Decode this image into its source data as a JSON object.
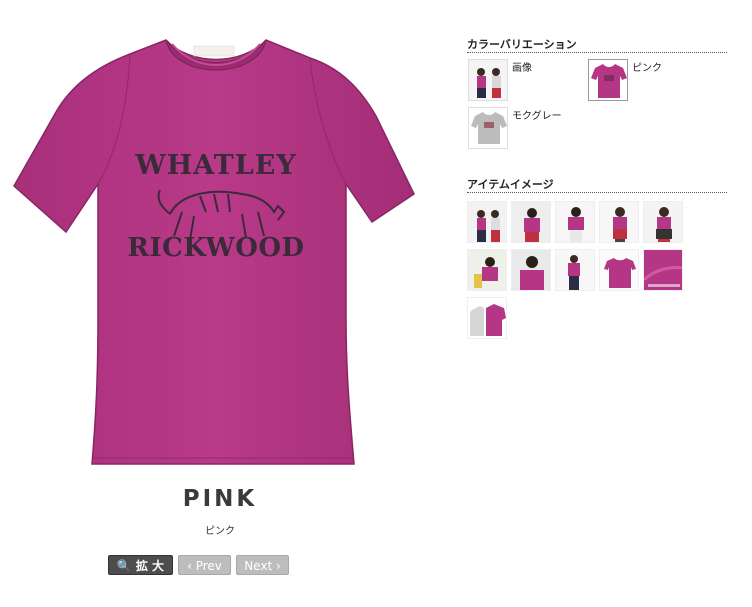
{
  "product": {
    "color_name_en": "PINK",
    "color_name_jp": "ピンク",
    "print_line1": "WHATLEY",
    "print_line2": "RICKWOOD"
  },
  "controls": {
    "zoom_label": "拡 大",
    "prev_label": "‹ Prev",
    "next_label": "Next ›"
  },
  "color_variation": {
    "title": "カラーバリエーション",
    "items": [
      {
        "label": "画像"
      },
      {
        "label": "ピンク",
        "selected": true
      },
      {
        "label": "モクグレー"
      }
    ]
  },
  "item_images": {
    "title": "アイテムイメージ",
    "count": 11
  },
  "colors": {
    "shirt_pink": "#b53685",
    "shirt_pink_dark": "#8f2766",
    "print_ink": "#3b2a3a",
    "grey": "#bcbcbc"
  }
}
